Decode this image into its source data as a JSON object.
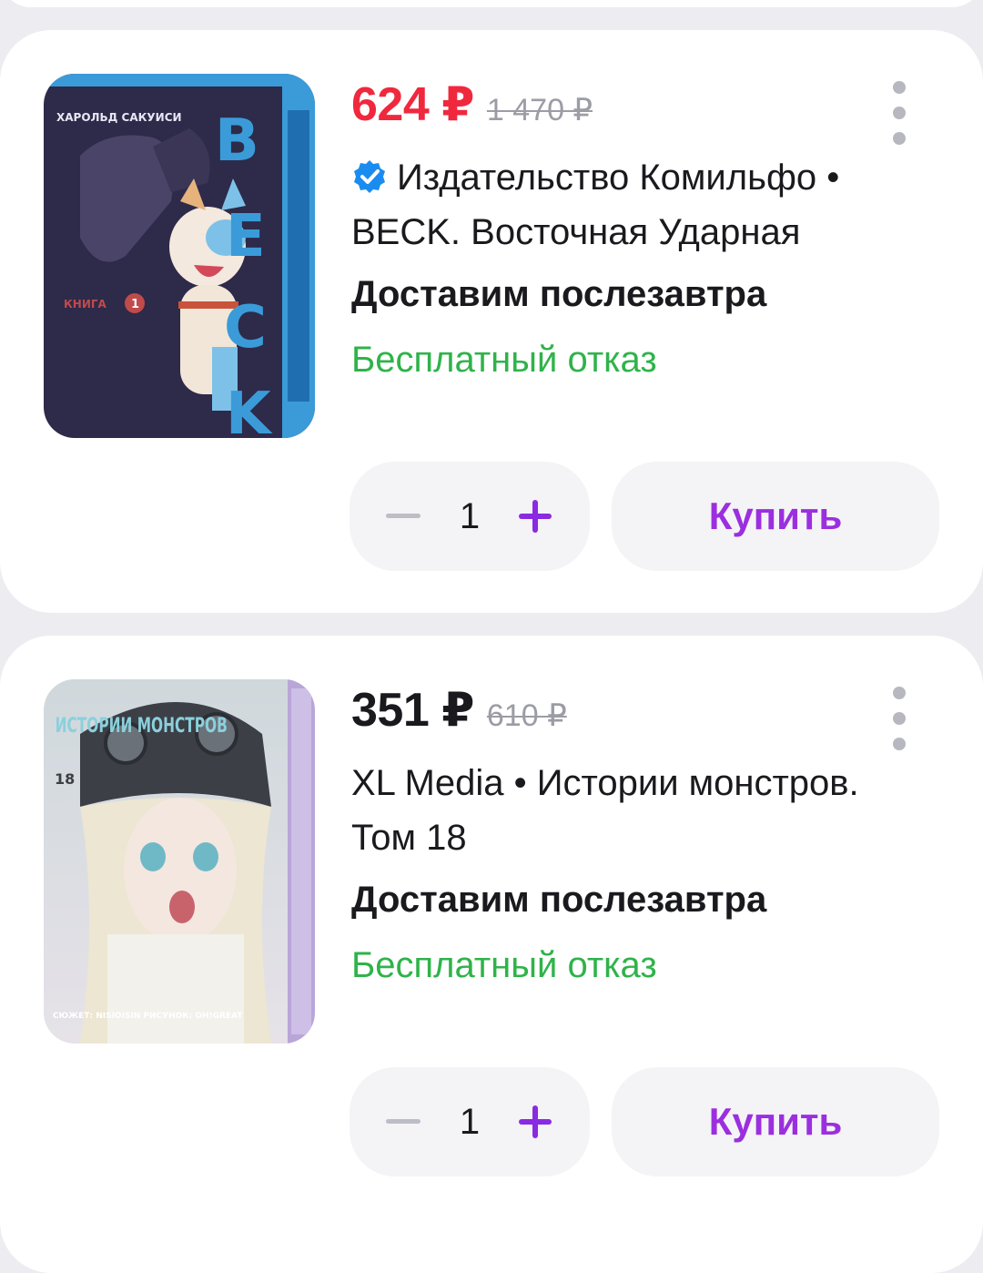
{
  "products": [
    {
      "price": "624 ₽",
      "old_price": "1 470 ₽",
      "price_color": "#f0283e",
      "verified": true,
      "title": "Издательство Комильфо • BECK. Восточная Ударная",
      "delivery": "Доставим послезавтра",
      "refund": "Бесплатный отказ",
      "quantity": "1",
      "buy_label": "Купить",
      "cover": {
        "author": "ХАРОЛЬД САКУИСИ",
        "series": "BECK",
        "volume_label": "КНИГА",
        "volume": "1"
      }
    },
    {
      "price": "351 ₽",
      "old_price": "610 ₽",
      "price_color": "#1a1a1e",
      "verified": false,
      "title": "XL Media • Истории монстров. Том 18",
      "delivery": "Доставим послезавтра",
      "refund": "Бесплатный отказ",
      "quantity": "1",
      "buy_label": "Купить",
      "cover": {
        "series": "ИСТОРИИ МОНСТРОВ",
        "volume": "18",
        "credits": "СЮЖЕТ: NISIOISIN  РИСУНОК: OH!GREAT"
      }
    }
  ],
  "colors": {
    "accent": "#9b2fdf",
    "refund_green": "#2fb34a",
    "sale_red": "#f0283e"
  }
}
